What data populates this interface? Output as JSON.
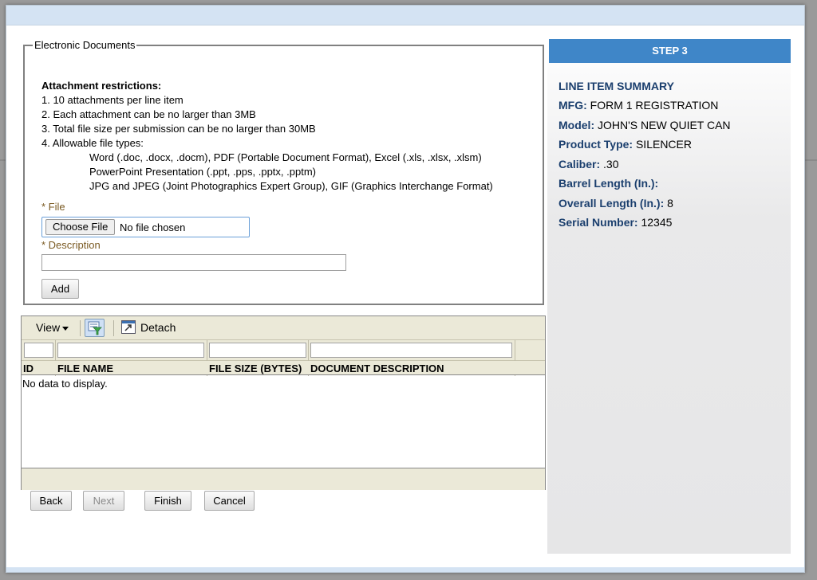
{
  "documents": {
    "legend": "Electronic Documents",
    "restrictions_title": "Attachment restrictions:",
    "restrictions": [
      "1. 10 attachments per line item",
      "2. Each attachment can be no larger than 3MB",
      "3. Total file size per submission can be no larger than 30MB",
      "4. Allowable file types:"
    ],
    "file_types": [
      "Word (.doc, .docx, .docm), PDF (Portable Document Format), Excel (.xls, .xlsx, .xlsm)",
      "PowerPoint Presentation (.ppt, .pps, .pptx, .pptm)",
      "JPG and JPEG (Joint Photographics Expert Group), GIF (Graphics Interchange Format)"
    ],
    "file_label": "* File",
    "choose_file_label": "Choose File",
    "no_file_text": "No file chosen",
    "description_label": "* Description",
    "description_value": "",
    "add_label": "Add"
  },
  "grid": {
    "view_label": "View",
    "filter_icon": "filter-icon",
    "detach_icon": "detach-icon",
    "detach_label": "Detach",
    "columns": [
      "ID",
      "FILE NAME",
      "FILE SIZE (BYTES)",
      "DOCUMENT DESCRIPTION"
    ],
    "empty_text": "No data to display."
  },
  "nav": {
    "back_label": "Back",
    "next_label": "Next",
    "finish_label": "Finish",
    "cancel_label": "Cancel"
  },
  "summary": {
    "step_label": "STEP 3",
    "title": "LINE ITEM SUMMARY",
    "items": [
      {
        "key": "MFG:",
        "value": "FORM 1 REGISTRATION"
      },
      {
        "key": "Model:",
        "value": "JOHN'S NEW QUIET CAN"
      },
      {
        "key": "Product Type:",
        "value": "SILENCER"
      },
      {
        "key": "Caliber:",
        "value": ".30"
      },
      {
        "key": "Barrel Length (In.):",
        "value": ""
      },
      {
        "key": "Overall Length (In.):",
        "value": "8"
      },
      {
        "key": "Serial Number:",
        "value": "12345"
      }
    ]
  },
  "colors": {
    "step_bar": "#3f86c8",
    "summary_key": "#1b3f6e",
    "required_label": "#7a5a22",
    "header": "#d4e3f3"
  }
}
